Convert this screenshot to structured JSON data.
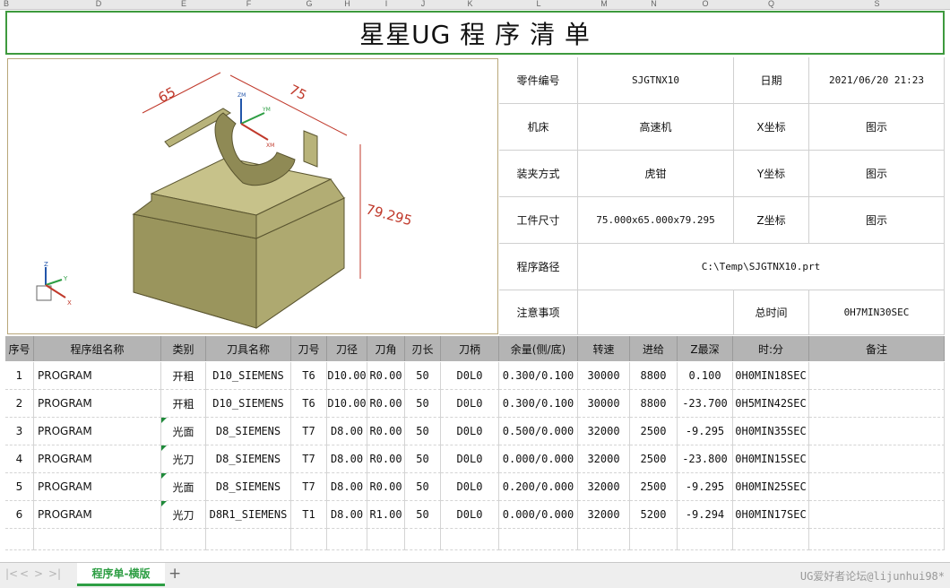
{
  "column_letters": [
    "B",
    "D",
    "E",
    "F",
    "G",
    "H",
    "I",
    "J",
    "K",
    "L",
    "M",
    "N",
    "O",
    "Q",
    "S"
  ],
  "title": "星星UG 程 序 清 单",
  "info": {
    "part_no_label": "零件编号",
    "part_no_value": "SJGTNX10",
    "date_label": "日期",
    "date_value": "2021/06/20 21:23",
    "machine_label": "机床",
    "machine_value": "高速机",
    "x_label": "X坐标",
    "x_value": "图示",
    "clamp_label": "装夹方式",
    "clamp_value": "虎钳",
    "y_label": "Y坐标",
    "y_value": "图示",
    "size_label": "工件尺寸",
    "size_value": "75.000x65.000x79.295",
    "z_label": "Z坐标",
    "z_value": "图示",
    "path_label": "程序路径",
    "path_value": "C:\\Temp\\SJGTNX10.prt",
    "note_label": "注意事项",
    "note_value": "",
    "total_label": "总时间",
    "total_value": "0H7MIN30SEC"
  },
  "model": {
    "dim_top_left": "65",
    "dim_top_right": "75",
    "dim_height": "79.295",
    "axis_x": "X",
    "axis_y": "Y",
    "axis_z": "Z",
    "wcs_x": "XM",
    "wcs_y": "YM",
    "wcs_z": "ZM",
    "colors": {
      "body": "#a8a36a",
      "edge": "#5a5530",
      "dim": "#c0392b"
    }
  },
  "table": {
    "headers": [
      "序号",
      "程序组名称",
      "类别",
      "刀具名称",
      "刀号",
      "刀径",
      "刀角",
      "刃长",
      "刀柄",
      "余量(侧/底)",
      "转速",
      "进给",
      "Z最深",
      "时:分",
      "备注"
    ],
    "rows": [
      [
        "1",
        "PROGRAM",
        "开粗",
        "D10_SIEMENS",
        "T6",
        "D10.00",
        "R0.00",
        "50",
        "D0L0",
        "0.300/0.100",
        "30000",
        "8800",
        "0.100",
        "0H0MIN18SEC",
        ""
      ],
      [
        "2",
        "PROGRAM",
        "开粗",
        "D10_SIEMENS",
        "T6",
        "D10.00",
        "R0.00",
        "50",
        "D0L0",
        "0.300/0.100",
        "30000",
        "8800",
        "-23.700",
        "0H5MIN42SEC",
        ""
      ],
      [
        "3",
        "PROGRAM",
        "光面",
        "D8_SIEMENS",
        "T7",
        "D8.00",
        "R0.00",
        "50",
        "D0L0",
        "0.500/0.000",
        "32000",
        "2500",
        "-9.295",
        "0H0MIN35SEC",
        ""
      ],
      [
        "4",
        "PROGRAM",
        "光刀",
        "D8_SIEMENS",
        "T7",
        "D8.00",
        "R0.00",
        "50",
        "D0L0",
        "0.000/0.000",
        "32000",
        "2500",
        "-23.800",
        "0H0MIN15SEC",
        ""
      ],
      [
        "5",
        "PROGRAM",
        "光面",
        "D8_SIEMENS",
        "T7",
        "D8.00",
        "R0.00",
        "50",
        "D0L0",
        "0.200/0.000",
        "32000",
        "2500",
        "-9.295",
        "0H0MIN25SEC",
        ""
      ],
      [
        "6",
        "PROGRAM",
        "光刀",
        "D8R1_SIEMENS",
        "T1",
        "D8.00",
        "R1.00",
        "50",
        "D0L0",
        "0.000/0.000",
        "32000",
        "5200",
        "-9.294",
        "0H0MIN17SEC",
        ""
      ],
      [
        "",
        "",
        "",
        "",
        "",
        "",
        "",
        "",
        "",
        "",
        "",
        "",
        "",
        "",
        ""
      ]
    ]
  },
  "tabs": {
    "sheet_name": "程序单-横版",
    "add": "+",
    "prev": "<",
    "next": ">",
    "last": ">|",
    "first": "|<"
  },
  "footer": "UG爱好者论坛@lijunhui98*"
}
